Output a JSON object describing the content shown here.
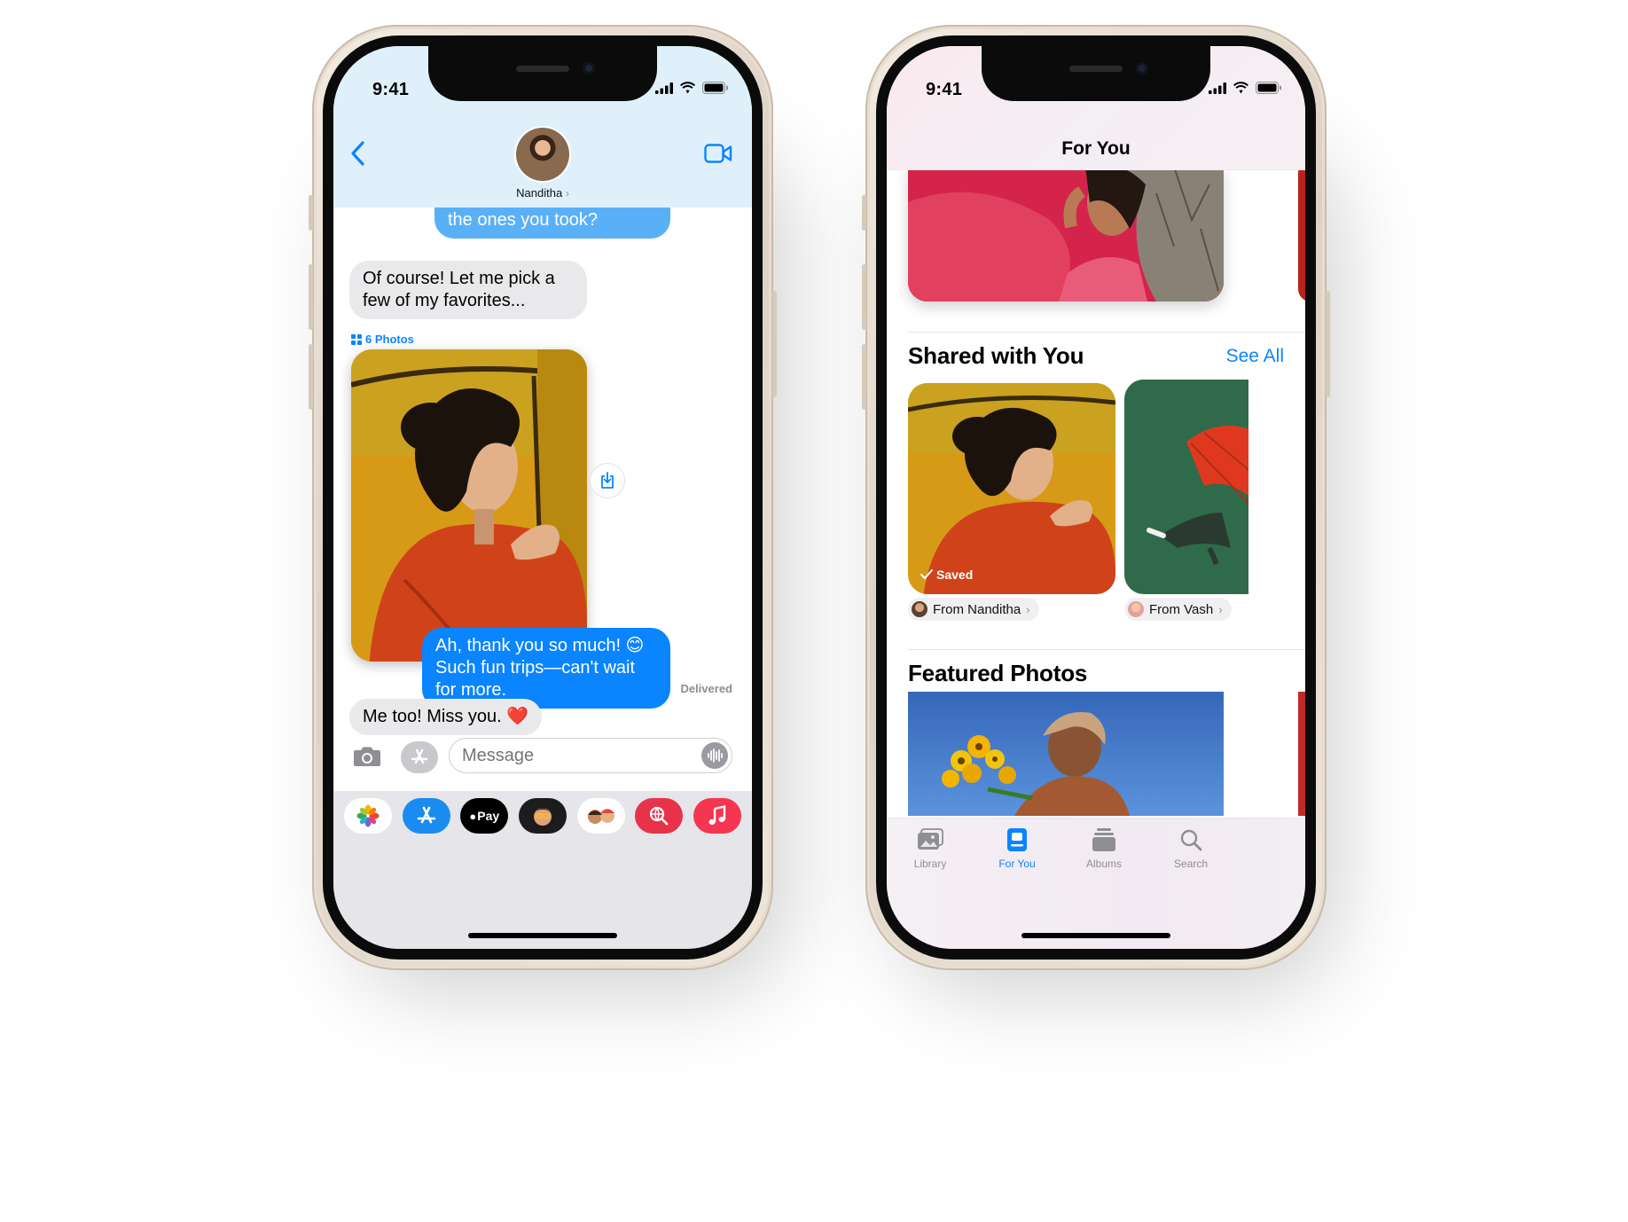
{
  "messages_phone": {
    "status": {
      "time": "9:41"
    },
    "header": {
      "contact_name": "Nanditha",
      "chevron": "›"
    },
    "bubbles": [
      {
        "id": "b1",
        "direction": "out",
        "text": "photos from our trips. Do you mind sharing some of the ones you took?"
      },
      {
        "id": "b2",
        "direction": "in",
        "text": "Of course! Let me pick a few of my favorites..."
      },
      {
        "id": "b3",
        "direction": "out",
        "text": "Ah, thank you so much! 😊 Such fun trips—can't wait for more."
      },
      {
        "id": "b4",
        "direction": "in",
        "text": "Me too! Miss you. ❤️"
      }
    ],
    "photos_label": "6 Photos",
    "delivered_label": "Delivered",
    "input": {
      "placeholder": "Message"
    },
    "app_drawer": {
      "apple_pay_label": "Pay"
    }
  },
  "photos_phone": {
    "status": {
      "time": "9:41"
    },
    "header": {
      "title": "For You"
    },
    "shared_section": {
      "title": "Shared with You",
      "see_all": "See All"
    },
    "shared_items": [
      {
        "saved_label": "Saved",
        "from": "From Nanditha",
        "chevron": "›"
      },
      {
        "from": "From Vash",
        "chevron": "›"
      }
    ],
    "featured_section": {
      "title": "Featured Photos"
    },
    "tabs": [
      {
        "label": "Library",
        "icon": "photo-library-icon"
      },
      {
        "label": "For You",
        "icon": "for-you-icon",
        "active": true
      },
      {
        "label": "Albums",
        "icon": "albums-icon"
      },
      {
        "label": "Search",
        "icon": "search-icon"
      }
    ]
  },
  "colors": {
    "imessage_blue": "#0a84ff",
    "incoming_bubble": "#e9e9eb",
    "accent": "#0a84ff",
    "phone_frame": "#e8ddd0"
  }
}
